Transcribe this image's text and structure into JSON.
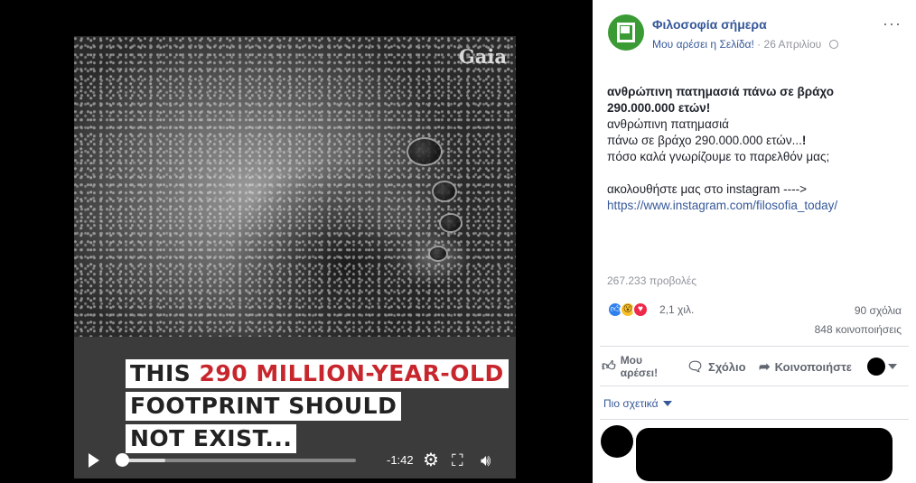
{
  "video": {
    "watermark": "Gaia",
    "caption_line1_a": "THIS ",
    "caption_line1_b": "290 MILLION-YEAR-OLD",
    "caption_line2": "FOOTPRINT SHOULD",
    "caption_line3": "NOT EXIST...",
    "time_remaining": "-1:42",
    "progress": 0.02,
    "buffered": 0.2,
    "highlight_color": "#c8262d"
  },
  "post": {
    "page_name": "Φιλοσοφία σήμερα",
    "like_page": "Μου αρέσει η Σελίδα!",
    "date": "26 Απριλίου",
    "more": "···",
    "title_line1": "ανθρώπινη πατημασιά πάνω σε βράχο",
    "title_line2": "290.000.000 ετών!",
    "body_line1": "ανθρώπινη πατημασιά",
    "body_line2": "πάνω σε βράχο 290.000.000 ετών...",
    "body_line2_bold": "!",
    "body_line3": "πόσο καλά γνωρίζουμε το παρελθόν μας;",
    "body_line4": "ακολουθήστε μας στο instagram ---->",
    "link": "https://www.instagram.com/filosofia_today/",
    "views": "267.233 προβολές",
    "reactions_count": "2,1 χιλ.",
    "comments": "90 σχόλια",
    "shares": "848 κοινοποιήσεις",
    "actions": {
      "like_line1": "Μου",
      "like_line2": "αρέσει!",
      "comment": "Σχόλιο",
      "share": "Κοινοποιήστε"
    },
    "sort": "Πιο σχετικά",
    "icons": {
      "like": "thumbs-up-icon",
      "comment": "speech-bubble-icon",
      "share": "share-arrow-icon"
    }
  }
}
